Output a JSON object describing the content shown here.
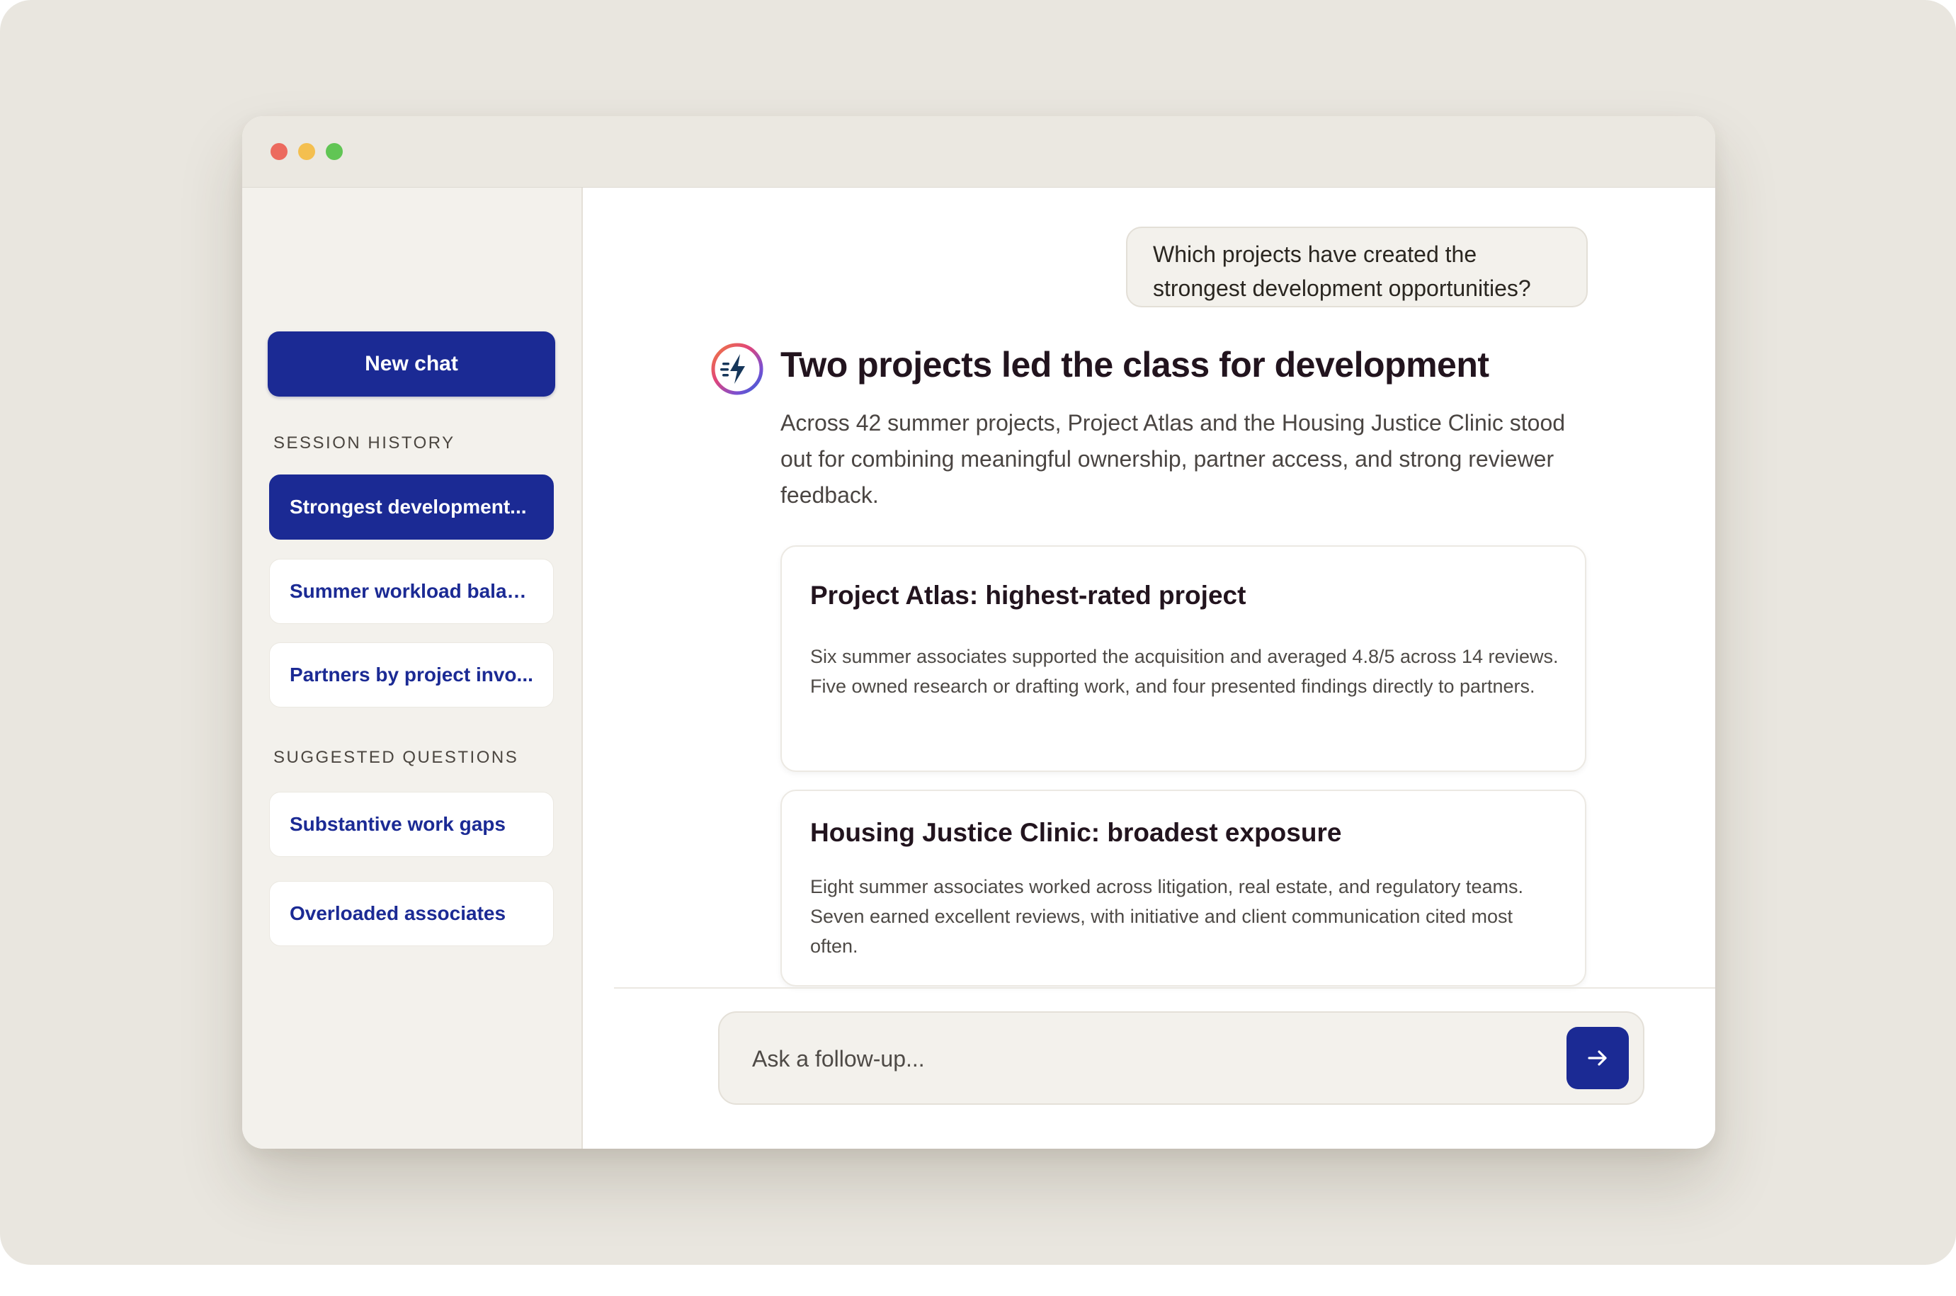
{
  "sidebar": {
    "new_chat_label": "New chat",
    "session_history_label": "SESSION HISTORY",
    "history_items": [
      {
        "label": "Strongest development...",
        "active": true
      },
      {
        "label": "Summer workload balan...",
        "active": false
      },
      {
        "label": "Partners by project invo...",
        "active": false
      }
    ],
    "suggested_label": "SUGGESTED QUESTIONS",
    "suggested_items": [
      {
        "label": "Substantive work gaps"
      },
      {
        "label": "Overloaded associates"
      }
    ]
  },
  "conversation": {
    "user_message": "Which projects have created the strongest development opportunities?",
    "response": {
      "title": "Two projects led the class for development",
      "summary": "Across 42 summer projects, Project Atlas and the Housing Justice Clinic stood out for combining meaningful ownership, partner access, and strong reviewer feedback.",
      "cards": [
        {
          "title": "Project Atlas: highest-rated project",
          "body": "Six summer associates supported the acquisition and averaged 4.8/5 across 14 reviews. Five owned research or drafting work, and four presented findings directly to partners."
        },
        {
          "title": "Housing Justice Clinic: broadest exposure",
          "body": "Eight summer associates worked across litigation, real estate, and regulatory teams. Seven earned excellent reviews, with initiative and client communication cited most often."
        }
      ]
    }
  },
  "composer": {
    "placeholder": "Ask a follow-up...",
    "send_icon": "arrow-right-icon"
  },
  "icons": {
    "avatar": "lightning-bolt-icon"
  },
  "colors": {
    "accent": "#1b2a94",
    "background": "#e9e6df",
    "sidebar_bg": "#f3f1ec",
    "heading": "#22141e"
  }
}
